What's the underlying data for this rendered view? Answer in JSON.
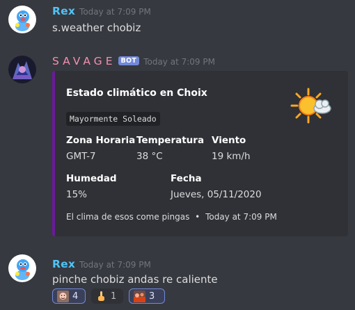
{
  "messages": [
    {
      "username": "Rex",
      "username_color": "#4fc3f7",
      "timestamp": "Today at 7:09 PM",
      "text": "s.weather chobiz"
    },
    {
      "username": "SAVAGE",
      "username_color": "#f48fb1",
      "bot_tag": "BOT",
      "timestamp": "Today at 7:09 PM",
      "embed": {
        "accent_color": "#6a1b9a",
        "title": "Estado climático en Choix",
        "code": "Mayormente Soleado",
        "thumbnail_icon": "sun-cloud-icon",
        "fields": [
          {
            "name": "Zona Horaria",
            "value": "GMT-7"
          },
          {
            "name": "Temperatura",
            "value": "38 °C"
          },
          {
            "name": "Viento",
            "value": "19 km/h"
          },
          {
            "name": "Humedad",
            "value": "15%"
          },
          {
            "name": "Fecha",
            "value": "Jueves, 05/11/2020"
          }
        ],
        "footer": "El clima de esos come pingas",
        "footer_separator": "•",
        "footer_time": "Today at 7:09 PM"
      }
    },
    {
      "username": "Rex",
      "username_color": "#4fc3f7",
      "timestamp": "Today at 7:09 PM",
      "text": "pinche chobiz andas re caliente",
      "reactions": [
        {
          "emoji": "face-emoji",
          "count": "4",
          "active": true
        },
        {
          "emoji": "middle-finger-emoji",
          "count": "1",
          "active": false
        },
        {
          "emoji": "scene-emoji",
          "count": "3",
          "active": true
        }
      ]
    }
  ]
}
